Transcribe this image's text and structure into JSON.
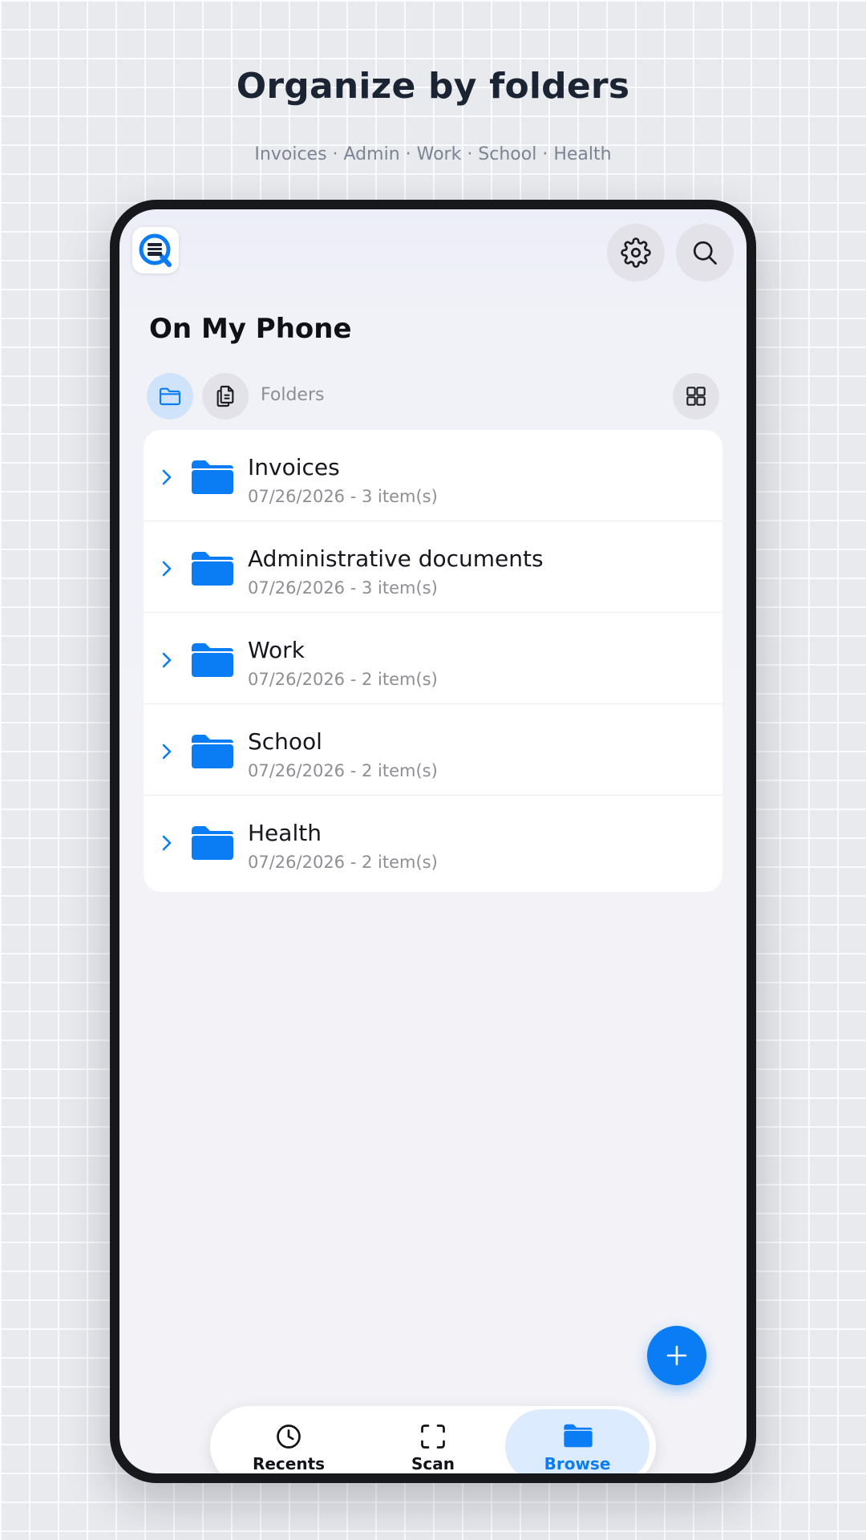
{
  "promo": {
    "headline": "Organize by folders",
    "subhead": "Invoices · Admin · Work · School · Health"
  },
  "header": {
    "logo_icon": "scanner-q-logo-icon",
    "settings_icon": "gear-icon",
    "search_icon": "search-icon"
  },
  "page": {
    "title": "On My Phone"
  },
  "filter": {
    "label": "Folders",
    "view_toggle_icons": [
      "folder-icon",
      "documents-icon"
    ],
    "layout_icon": "grid-icon"
  },
  "folders": [
    {
      "name": "Invoices",
      "meta": "07/26/2026 - 3 item(s)"
    },
    {
      "name": "Administrative documents",
      "meta": "07/26/2026 - 3 item(s)"
    },
    {
      "name": "Work",
      "meta": "07/26/2026 - 2 item(s)"
    },
    {
      "name": "School",
      "meta": "07/26/2026 - 2 item(s)"
    },
    {
      "name": "Health",
      "meta": "07/26/2026 - 2 item(s)"
    }
  ],
  "fab": {
    "icon": "plus-icon"
  },
  "bottom_nav": {
    "active": "Browse",
    "tabs": [
      {
        "label": "Recents",
        "icon": "clock-icon"
      },
      {
        "label": "Scan",
        "icon": "scan-frame-icon"
      },
      {
        "label": "Browse",
        "icon": "folder-icon"
      }
    ]
  },
  "colors": {
    "accent": "#0A7CF4",
    "folder": "#0A7CF4",
    "background": "#F2F2F7",
    "active_tab_bg": "#DCEBFD"
  }
}
